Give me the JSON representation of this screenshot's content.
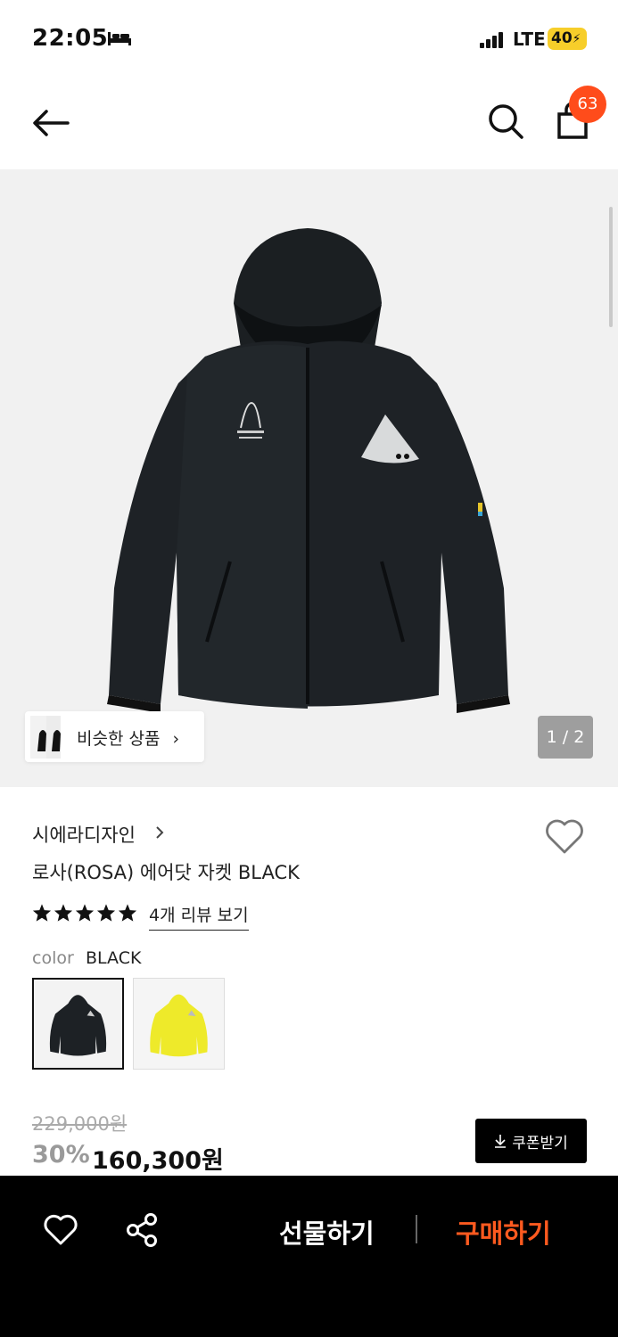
{
  "status_bar": {
    "time": "22:05",
    "network": "LTE",
    "battery": "40"
  },
  "nav": {
    "cart_count": "63"
  },
  "gallery": {
    "similar_label": "비슷한 상품",
    "page_indicator": "1 / 2"
  },
  "product": {
    "brand": "시에라디자인",
    "name": "로사(ROSA) 에어닷 자켓 BLACK",
    "rating": 5,
    "review_link": "4개 리뷰 보기",
    "color_label": "color",
    "color_value": "BLACK",
    "color_options": [
      "black",
      "yellow"
    ],
    "original_price": "229,000원",
    "discount": "30%",
    "price": "160,300원",
    "coupon_label": "쿠폰받기"
  },
  "bottom_bar": {
    "gift_label": "선물하기",
    "buy_label": "구매하기"
  },
  "colors": {
    "accent": "#ff4c1b",
    "buy": "#ff5a1f",
    "battery": "#f7ce2a"
  }
}
